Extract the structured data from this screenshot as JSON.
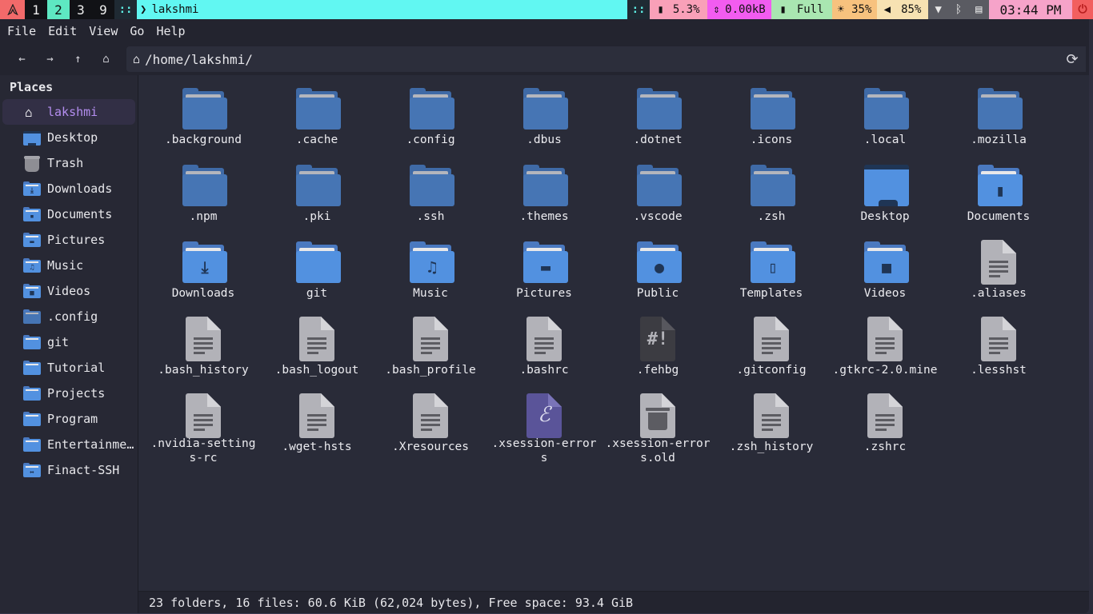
{
  "topbar": {
    "logo_icon": "arch-linux-icon",
    "workspaces": [
      {
        "label": "1",
        "active": false
      },
      {
        "label": "2",
        "active": true
      },
      {
        "label": "3",
        "active": false
      },
      {
        "label": "9",
        "active": false
      }
    ],
    "layout_glyph": "::",
    "window_title_prefix": "❯",
    "window_title": "lakshmi",
    "separator_glyph": "::",
    "cpu": "5.3%",
    "network": "0.00kB",
    "battery": "Full",
    "brightness": "35%",
    "volume": "85%",
    "clock": "03:44 PM",
    "colors": {
      "logo": "#f26a6a",
      "active_workspace": "#5ee8c2",
      "title": "#61f7f2",
      "cpu": "#f9a0b8",
      "network": "#f25cf0",
      "battery": "#a9e6b1",
      "brightness": "#f7c27e",
      "volume": "#f7e2b2",
      "clock": "#f6a3c9",
      "power": "#f25f5f"
    }
  },
  "menu": [
    "File",
    "Edit",
    "View",
    "Go",
    "Help"
  ],
  "toolbar": {
    "back_icon": "←",
    "forward_icon": "→",
    "up_icon": "↑",
    "home_icon": "⌂",
    "path": "/home/lakshmi/",
    "reload_icon": "⟳"
  },
  "sidebar": {
    "heading": "Places",
    "items": [
      {
        "label": "lakshmi",
        "icon": "home",
        "active": true
      },
      {
        "label": "Desktop",
        "icon": "desktop"
      },
      {
        "label": "Trash",
        "icon": "trash"
      },
      {
        "label": "Downloads",
        "icon": "downloads"
      },
      {
        "label": "Documents",
        "icon": "documents"
      },
      {
        "label": "Pictures",
        "icon": "pictures"
      },
      {
        "label": "Music",
        "icon": "music"
      },
      {
        "label": "Videos",
        "icon": "videos"
      },
      {
        "label": ".config",
        "icon": "folder-dim"
      },
      {
        "label": "git",
        "icon": "folder"
      },
      {
        "label": "Tutorial",
        "icon": "folder"
      },
      {
        "label": "Projects",
        "icon": "folder"
      },
      {
        "label": "Program",
        "icon": "folder"
      },
      {
        "label": "Entertainme…",
        "icon": "folder"
      },
      {
        "label": "Finact-SSH",
        "icon": "network-folder"
      }
    ]
  },
  "files": [
    {
      "name": ".background",
      "type": "folder-hidden"
    },
    {
      "name": ".cache",
      "type": "folder-hidden"
    },
    {
      "name": ".config",
      "type": "folder-hidden"
    },
    {
      "name": ".dbus",
      "type": "folder-hidden"
    },
    {
      "name": ".dotnet",
      "type": "folder-hidden"
    },
    {
      "name": ".icons",
      "type": "folder-hidden"
    },
    {
      "name": ".local",
      "type": "folder-hidden"
    },
    {
      "name": ".mozilla",
      "type": "folder-hidden"
    },
    {
      "name": ".npm",
      "type": "folder-hidden"
    },
    {
      "name": ".pki",
      "type": "folder-hidden"
    },
    {
      "name": ".ssh",
      "type": "folder-hidden"
    },
    {
      "name": ".themes",
      "type": "folder-hidden"
    },
    {
      "name": ".vscode",
      "type": "folder-hidden"
    },
    {
      "name": ".zsh",
      "type": "folder-hidden"
    },
    {
      "name": "Desktop",
      "type": "desktop"
    },
    {
      "name": "Documents",
      "type": "folder-documents"
    },
    {
      "name": "Downloads",
      "type": "folder-downloads"
    },
    {
      "name": "git",
      "type": "folder"
    },
    {
      "name": "Music",
      "type": "folder-music"
    },
    {
      "name": "Pictures",
      "type": "folder-pictures"
    },
    {
      "name": "Public",
      "type": "folder-public"
    },
    {
      "name": "Templates",
      "type": "folder-templates"
    },
    {
      "name": "Videos",
      "type": "folder-videos"
    },
    {
      "name": ".aliases",
      "type": "text"
    },
    {
      "name": ".bash_history",
      "type": "text"
    },
    {
      "name": ".bash_logout",
      "type": "text"
    },
    {
      "name": ".bash_profile",
      "type": "text"
    },
    {
      "name": ".bashrc",
      "type": "text"
    },
    {
      "name": ".fehbg",
      "type": "script"
    },
    {
      "name": ".gitconfig",
      "type": "text"
    },
    {
      "name": ".gtkrc-2.0.mine",
      "type": "text"
    },
    {
      "name": ".lesshst",
      "type": "text"
    },
    {
      "name": ".nvidia-settings-rc",
      "type": "text"
    },
    {
      "name": ".wget-hsts",
      "type": "text"
    },
    {
      "name": ".Xresources",
      "type": "text"
    },
    {
      "name": ".xsession-errors",
      "type": "emacs"
    },
    {
      "name": ".xsession-errors.old",
      "type": "trash"
    },
    {
      "name": ".zsh_history",
      "type": "text"
    },
    {
      "name": ".zshrc",
      "type": "text"
    }
  ],
  "status": "23 folders, 16 files: 60.6 KiB (62,024 bytes), Free space: 93.4 GiB"
}
